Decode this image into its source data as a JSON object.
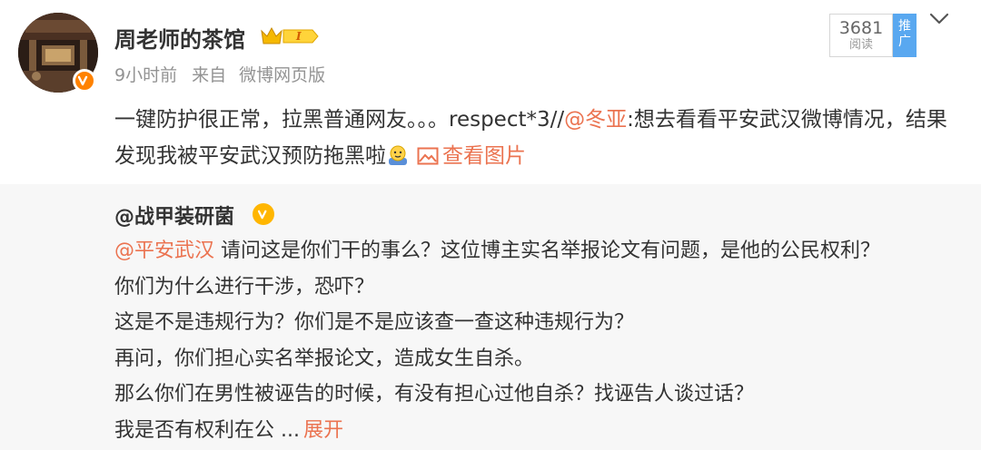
{
  "post": {
    "username": "周老师的茶馆",
    "level_badge": "I",
    "time": "9小时前",
    "source_prefix": "来自",
    "source": "微博网页版",
    "read_count": "3681",
    "read_label": "阅读",
    "promote_label": "推广",
    "text_before": "一键防护很正常，拉黑普通网友。。。respect*3//",
    "mention": "@冬亚",
    "text_after": ":想去看看平安武汉微博情况，结果发现我被平安武汉预防拖黑啦",
    "view_image_label": "查看图片"
  },
  "repost": {
    "username": "@战甲装研菌",
    "mention": "@平安武汉",
    "line1_rest": " 请问这是你们干的事么？这位博主实名举报论文有问题，是他的公民权利？",
    "line2": "你们为什么进行干涉，恐吓？",
    "line3": "这是不是违规行为？你们是不是应该查一查这种违规行为？",
    "line4": "再问，你们担心实名举报论文，造成女生自杀。",
    "line5": "那么你们在男性被诬告的时候，有没有担心过他自杀？找诬告人谈过话？",
    "line6": "我是否有权利在公 ...",
    "expand_label": "展开"
  },
  "colors": {
    "link": "#eb7350",
    "meta": "#939393",
    "repost_bg": "#f7f7f7",
    "verified_orange": "#ff8200",
    "verified_gold": "#ffb600",
    "promote_blue": "#59a8f0"
  },
  "icons": [
    "verified-icon",
    "crown-level-icon",
    "chevron-down-icon",
    "emoji-icon",
    "picture-icon"
  ]
}
